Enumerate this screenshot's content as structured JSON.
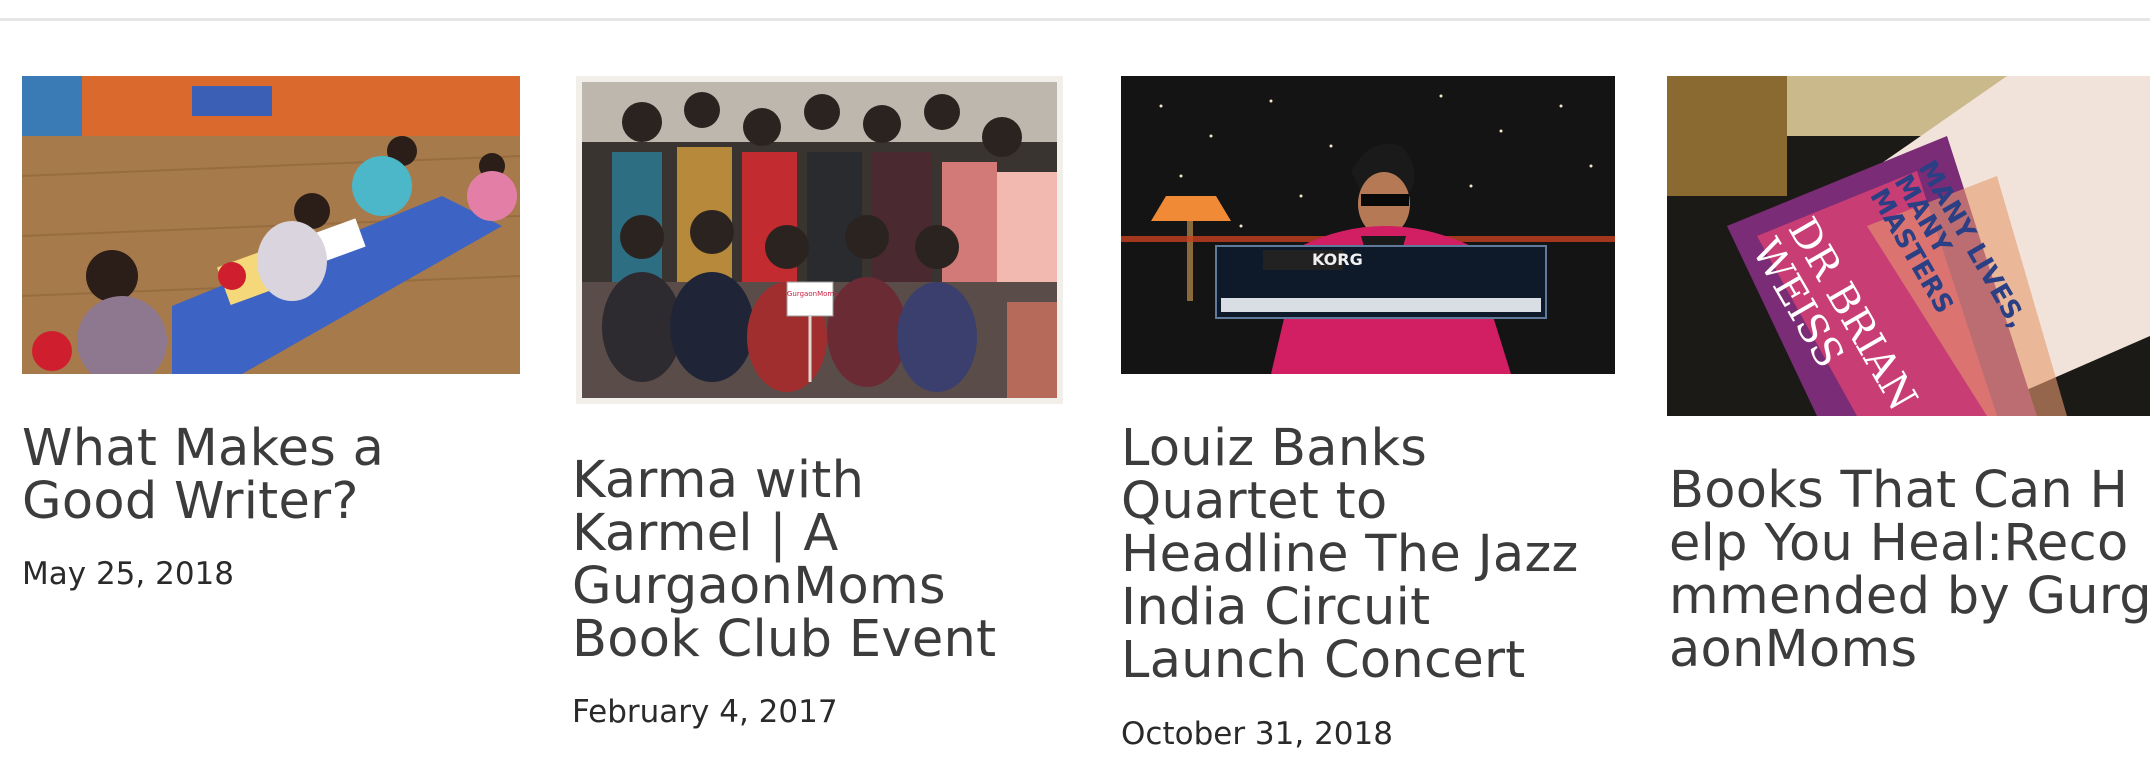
{
  "posts": [
    {
      "title": "What Makes a Good Writer?",
      "date": "May 25, 2018",
      "image_subject": "children writing at classroom tables"
    },
    {
      "title": "Karma with Karmel | A GurgaonMoms Book Club Event",
      "date": "February 4, 2017",
      "image_subject": "group photo of women at book club event",
      "sign_text": "GurgaonMoms"
    },
    {
      "title": "Louiz Banks Quartet to Headline The Jazz India Circuit Launch Concert",
      "date": "October 31, 2018",
      "image_subject": "musician playing KORG keyboard on stage",
      "keyboard_brand": "KORG"
    },
    {
      "title": "Books That Can Help You Heal:Recommended by GurgaonMoms",
      "date": "",
      "image_subject": "book cover Many Lives, Many Masters by Dr Brian Weiss",
      "book_title": "MANY LIVES, MANY MASTERS",
      "book_author": "DR BRIAN WEISS"
    }
  ],
  "colors": {
    "accent_red": "#c81e3c",
    "title_text": "#3c3c3c"
  }
}
